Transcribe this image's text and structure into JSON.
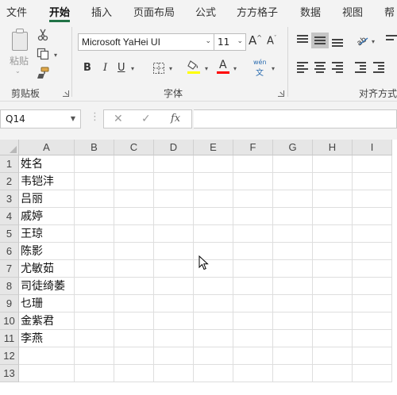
{
  "menu": {
    "tabs": [
      "文件",
      "开始",
      "插入",
      "页面布局",
      "公式",
      "方方格子",
      "数据",
      "视图",
      "帮"
    ],
    "active_index": 1
  },
  "ribbon": {
    "clipboard": {
      "paste_label": "粘贴",
      "group_label": "剪贴板"
    },
    "font": {
      "font_name": "Microsoft YaHei UI",
      "font_size": "11",
      "grow_label": "A",
      "shrink_label": "A",
      "bold_label": "B",
      "italic_label": "I",
      "underline_label": "U",
      "font_color_label": "A",
      "phonetic_top": "wén",
      "phonetic_bottom": "文",
      "group_label": "字体",
      "highlight_color": "#ffff00",
      "font_color": "#ff0000"
    },
    "alignment": {
      "group_label": "对齐方式"
    }
  },
  "formula_bar": {
    "name_box": "Q14",
    "cancel_icon": "✕",
    "enter_icon": "✓",
    "fx_label": "fx",
    "formula": ""
  },
  "sheet": {
    "columns": [
      "A",
      "B",
      "C",
      "D",
      "E",
      "F",
      "G",
      "H",
      "I"
    ],
    "rows": [
      "1",
      "2",
      "3",
      "4",
      "5",
      "6",
      "7",
      "8",
      "9",
      "10",
      "11",
      "12",
      "13"
    ],
    "column_a_values": [
      "姓名",
      "韦铠沣",
      "吕丽",
      "戚婷",
      "王琼",
      "陈影",
      "尤敏茹",
      "司徒绮萎",
      "乜珊",
      "金紫君",
      "李燕",
      "",
      ""
    ]
  }
}
